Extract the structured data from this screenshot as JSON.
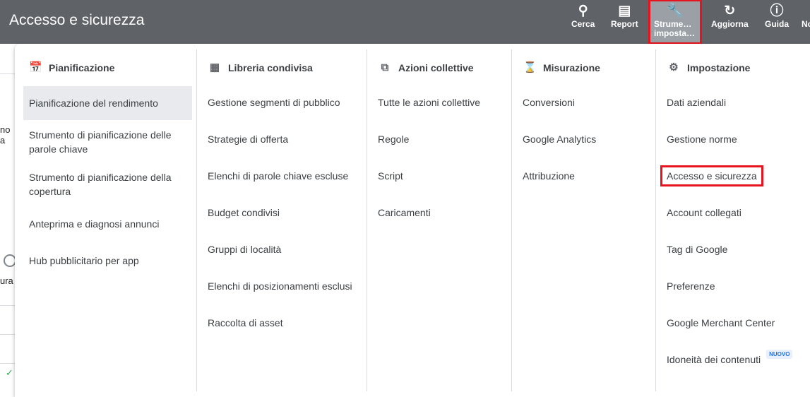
{
  "header": {
    "title": "Accesso e sicurezza",
    "buttons": [
      {
        "label": "Cerca",
        "icon": "search-icon"
      },
      {
        "label": "Report",
        "icon": "report-icon"
      },
      {
        "label1": "Strume…",
        "label2": "imposta…",
        "icon": "wrench-icon"
      },
      {
        "label": "Aggiorna",
        "icon": "refresh-icon"
      },
      {
        "label": "Guida",
        "icon": "help-icon"
      },
      {
        "label": "No",
        "icon": "notifications-icon"
      }
    ]
  },
  "background": {
    "text1": "no a",
    "text2": "ura"
  },
  "menu": {
    "columns": [
      {
        "title": "Pianificazione",
        "icon": "calendar-icon",
        "items": [
          "Pianificazione del rendimento",
          "Strumento di pianificazione delle parole chiave",
          "Strumento di pianificazione della copertura",
          "Anteprima e diagnosi annunci",
          "Hub pubblicitario per app"
        ]
      },
      {
        "title": "Libreria condivisa",
        "icon": "library-icon",
        "items": [
          "Gestione segmenti di pubblico",
          "Strategie di offerta",
          "Elenchi di parole chiave escluse",
          "Budget condivisi",
          "Gruppi di località",
          "Elenchi di posizionamenti esclusi",
          "Raccolta di asset"
        ]
      },
      {
        "title": "Azioni collettive",
        "icon": "copy-icon",
        "items": [
          "Tutte le azioni collettive",
          "Regole",
          "Script",
          "Caricamenti"
        ]
      },
      {
        "title": "Misurazione",
        "icon": "hourglass-icon",
        "items": [
          "Conversioni",
          "Google Analytics",
          "Attribuzione"
        ]
      },
      {
        "title": "Impostazione",
        "icon": "settings-icon",
        "items": [
          "Dati aziendali",
          "Gestione norme",
          "Accesso e sicurezza",
          "Account collegati",
          "Tag di Google",
          "Preferenze",
          "Google Merchant Center",
          "Idoneità dei contenuti"
        ],
        "badge": "NUOVO"
      }
    ]
  },
  "colors": {
    "header": "#5f6368",
    "highlight_outline": "#e8141d",
    "badge": "#1a73e8"
  }
}
